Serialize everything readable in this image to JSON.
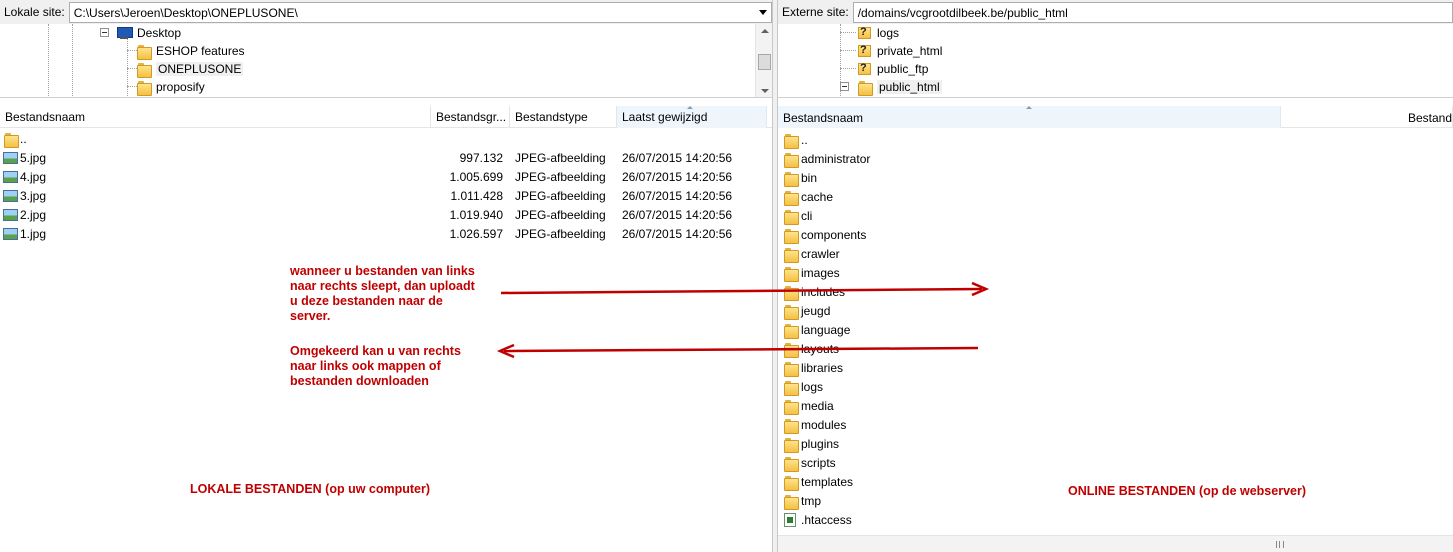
{
  "local": {
    "site_label": "Lokale site:",
    "path": "C:\\Users\\Jeroen\\Desktop\\ONEPLUSONE\\",
    "tree": [
      {
        "label": "Desktop",
        "icon": "computer-icon"
      },
      {
        "label": "ESHOP features",
        "icon": "folder-icon"
      },
      {
        "label": "ONEPLUSONE",
        "icon": "folder-icon",
        "selected": true
      },
      {
        "label": "proposify",
        "icon": "folder-icon"
      }
    ],
    "columns": [
      "Bestandsnaam",
      "Bestandsgr...",
      "Bestandstype",
      "Laatst gewijzigd"
    ],
    "files": [
      {
        "name": "..",
        "size": "",
        "type": "",
        "modified": "",
        "icon": "folder-icon"
      },
      {
        "name": "5.jpg",
        "size": "997.132",
        "type": "JPEG-afbeelding",
        "modified": "26/07/2015 14:20:56",
        "icon": "image-icon"
      },
      {
        "name": "4.jpg",
        "size": "1.005.699",
        "type": "JPEG-afbeelding",
        "modified": "26/07/2015 14:20:56",
        "icon": "image-icon"
      },
      {
        "name": "3.jpg",
        "size": "1.011.428",
        "type": "JPEG-afbeelding",
        "modified": "26/07/2015 14:20:56",
        "icon": "image-icon"
      },
      {
        "name": "2.jpg",
        "size": "1.019.940",
        "type": "JPEG-afbeelding",
        "modified": "26/07/2015 14:20:56",
        "icon": "image-icon"
      },
      {
        "name": "1.jpg",
        "size": "1.026.597",
        "type": "JPEG-afbeelding",
        "modified": "26/07/2015 14:20:56",
        "icon": "image-icon"
      }
    ]
  },
  "remote": {
    "site_label": "Externe site:",
    "path": "/domains/vcgrootdilbeek.be/public_html",
    "tree": [
      {
        "label": "logs",
        "icon": "unknown-folder-icon"
      },
      {
        "label": "private_html",
        "icon": "unknown-folder-icon"
      },
      {
        "label": "public_ftp",
        "icon": "unknown-folder-icon"
      },
      {
        "label": "public_html",
        "icon": "folder-icon",
        "selected": true
      }
    ],
    "columns": [
      "Bestandsnaam",
      "Bestand"
    ],
    "files": [
      {
        "name": "..",
        "icon": "folder-icon"
      },
      {
        "name": "administrator",
        "icon": "folder-icon"
      },
      {
        "name": "bin",
        "icon": "folder-icon"
      },
      {
        "name": "cache",
        "icon": "folder-icon"
      },
      {
        "name": "cli",
        "icon": "folder-icon"
      },
      {
        "name": "components",
        "icon": "folder-icon"
      },
      {
        "name": "crawler",
        "icon": "folder-icon"
      },
      {
        "name": "images",
        "icon": "folder-icon"
      },
      {
        "name": "includes",
        "icon": "folder-icon"
      },
      {
        "name": "jeugd",
        "icon": "folder-icon"
      },
      {
        "name": "language",
        "icon": "folder-icon"
      },
      {
        "name": "layouts",
        "icon": "folder-icon"
      },
      {
        "name": "libraries",
        "icon": "folder-icon"
      },
      {
        "name": "logs",
        "icon": "folder-icon"
      },
      {
        "name": "media",
        "icon": "folder-icon"
      },
      {
        "name": "modules",
        "icon": "folder-icon"
      },
      {
        "name": "plugins",
        "icon": "folder-icon"
      },
      {
        "name": "scripts",
        "icon": "folder-icon"
      },
      {
        "name": "templates",
        "icon": "folder-icon"
      },
      {
        "name": "tmp",
        "icon": "folder-icon"
      },
      {
        "name": ".htaccess",
        "icon": "htaccess-file-icon"
      }
    ]
  },
  "annotations": {
    "upload_note": [
      "wanneer u bestanden van links",
      "naar rechts sleept, dan uploadt",
      "u deze bestanden naar de",
      "server."
    ],
    "download_note": [
      "Omgekeerd kan u van rechts",
      "naar links ook mappen of",
      "bestanden downloaden"
    ],
    "local_caption": "LOKALE BESTANDEN (op uw computer)",
    "online_caption": "ONLINE BESTANDEN (op de webserver)",
    "color": "#c00000"
  }
}
